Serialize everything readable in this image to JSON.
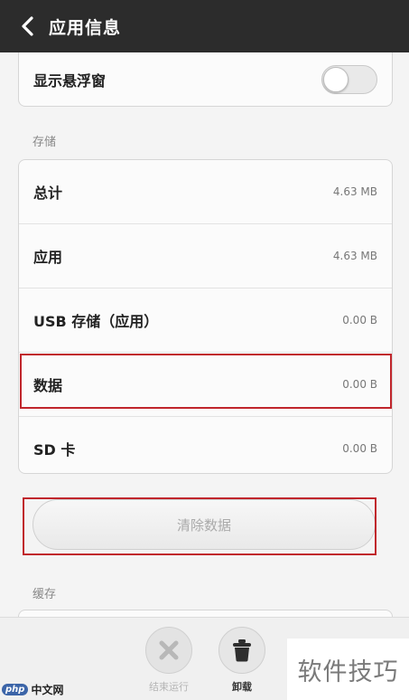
{
  "header": {
    "title": "应用信息"
  },
  "floating_window": {
    "label": "显示悬浮窗",
    "enabled": false
  },
  "storage": {
    "section_title": "存储",
    "rows": [
      {
        "label": "总计",
        "value": "4.63 MB"
      },
      {
        "label": "应用",
        "value": "4.63 MB"
      },
      {
        "label": "USB 存储（应用）",
        "value": "0.00 B"
      },
      {
        "label": "数据",
        "value": "0.00 B"
      },
      {
        "label": "SD 卡",
        "value": "0.00 B"
      }
    ]
  },
  "clear_data": {
    "label": "清除数据"
  },
  "cache": {
    "section_title": "缓存"
  },
  "bottom_bar": {
    "stop_label": "结束运行",
    "uninstall_label": "卸载"
  },
  "watermarks": {
    "php_badge": "php",
    "php_site": "中文网",
    "right_text": "软件技巧"
  },
  "colors": {
    "titlebar": "#2c2c2c",
    "highlight": "#c0262c"
  }
}
